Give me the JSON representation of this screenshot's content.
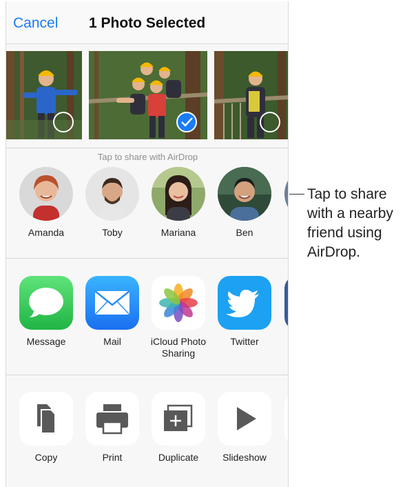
{
  "navbar": {
    "cancel": "Cancel",
    "title": "1 Photo Selected"
  },
  "photos": [
    {
      "selected": false
    },
    {
      "selected": true
    },
    {
      "selected": false
    }
  ],
  "airdrop": {
    "hint": "Tap to share with AirDrop",
    "contacts": [
      {
        "name": "Amanda"
      },
      {
        "name": "Toby"
      },
      {
        "name": "Mariana"
      },
      {
        "name": "Ben"
      }
    ]
  },
  "apps": [
    {
      "label": "Message",
      "icon": "messages-icon",
      "color": "#34c759"
    },
    {
      "label": "Mail",
      "icon": "mail-icon",
      "color": "#1a7cf5"
    },
    {
      "label": "iCloud Photo Sharing",
      "icon": "photos-icon",
      "color": "#ffffff"
    },
    {
      "label": "Twitter",
      "icon": "twitter-icon",
      "color": "#1da1f2"
    }
  ],
  "actions": [
    {
      "label": "Copy",
      "icon": "copy-icon"
    },
    {
      "label": "Print",
      "icon": "print-icon"
    },
    {
      "label": "Duplicate",
      "icon": "duplicate-icon"
    },
    {
      "label": "Slideshow",
      "icon": "slideshow-icon"
    }
  ],
  "callout": "Tap to share with a nearby friend using AirDrop."
}
